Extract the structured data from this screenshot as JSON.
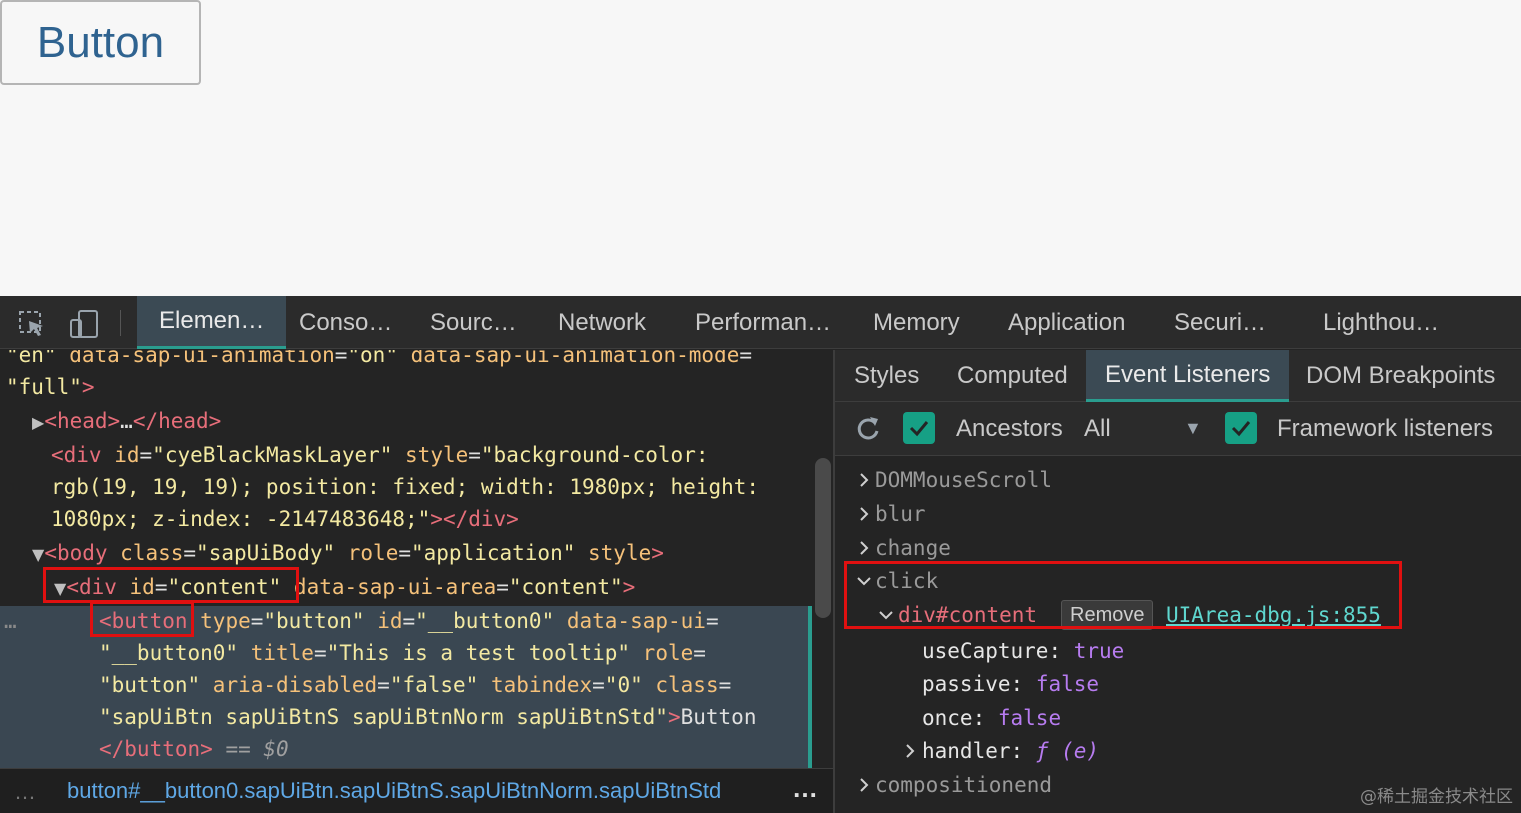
{
  "page": {
    "button_label": "Button"
  },
  "devtools": {
    "main_tabs": [
      "Elemen…",
      "Conso…",
      "Sourc…",
      "Network",
      "Performan…",
      "Memory",
      "Application",
      "Securi…",
      "Lighthou…"
    ],
    "elements": {
      "line1": {
        "v1": "\"en\"",
        "a1": " data-sap-ui-animation",
        "v2": "\"on\"",
        "a2": " data-sap-ui-animation-mode"
      },
      "line2": {
        "v1": "\"full\""
      },
      "line3": {
        "open": "<head>",
        "dots": "…",
        "close": "</head>"
      },
      "line4": {
        "tag": "<div",
        "a1": " id",
        "v1": "\"cyeBlackMaskLayer\"",
        "a2": " style",
        "v2": "\"background-color:"
      },
      "line5": {
        "v": "rgb(19, 19, 19); position: fixed; width: 1980px; height:"
      },
      "line6": {
        "v": "1080px; z-index: -2147483648;\"",
        "close": "</div>"
      },
      "line7": {
        "tag": "<body",
        "a1": " class",
        "v1": "\"sapUiBody\"",
        "a2": " role",
        "v2": "\"application\"",
        "a3": " style"
      },
      "line8": {
        "tag": "<div",
        "a1": " id",
        "v1": "\"content\"",
        "a2": " data-sap-ui-area",
        "v2": "\"content\""
      },
      "line9": {
        "tag": "<button",
        "a1": " type",
        "v1": "\"button\"",
        "a2": " id",
        "v2": "\"__button0\"",
        "a3": " data-sap-ui"
      },
      "line10": {
        "v1": "\"__button0\"",
        "a1": " title",
        "v2": "\"This is a test tooltip\"",
        "a2": " role"
      },
      "line11": {
        "v1": "\"button\"",
        "a1": " aria-disabled",
        "v2": "\"false\"",
        "a2": " tabindex",
        "v3": "\"0\"",
        "a3": " class"
      },
      "line12": {
        "v1": "\"sapUiBtn sapUiBtnS sapUiBtnNorm sapUiBtnStd\"",
        "txt": "Button"
      },
      "line13": {
        "close": "</button>",
        "eq": " == ",
        "ref": "$0"
      }
    },
    "breadcrumb": "button#__button0.sapUiBtn.sapUiBtnS.sapUiBtnNorm.sapUiBtnStd",
    "breadcrumb_more": "…",
    "side_tabs": [
      "Styles",
      "Computed",
      "Event Listeners",
      "DOM Breakpoints"
    ],
    "toolbar": {
      "ancestors_label": "Ancestors",
      "filter_value": "All",
      "framework_label": "Framework listeners"
    },
    "listeners": {
      "events": [
        "DOMMouseScroll",
        "blur",
        "change",
        "click",
        "compositionend"
      ],
      "click_target": "div#content",
      "remove_label": "Remove",
      "source_link": "UIArea-dbg.js:855",
      "props": [
        {
          "key": "useCapture",
          "value": "true"
        },
        {
          "key": "passive",
          "value": "false"
        },
        {
          "key": "once",
          "value": "false"
        }
      ],
      "handler_key": "handler",
      "handler_value": "ƒ (e)"
    },
    "watermark": "@稀土掘金技术社区"
  }
}
